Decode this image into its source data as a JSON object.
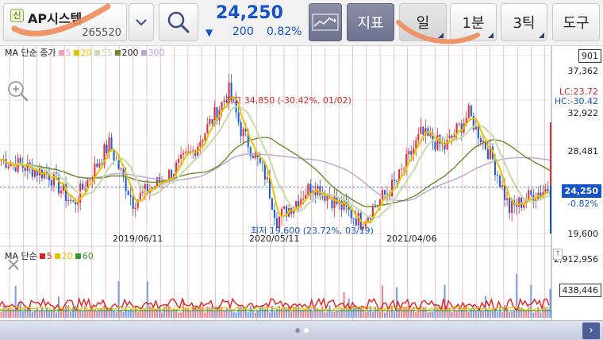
{
  "header": {
    "badge": "신",
    "stock_name": "AP시스템",
    "stock_code": "265520",
    "price": "24,250",
    "change_arrow": "▼",
    "change": "200",
    "change_pct": "0.82%",
    "indicator_btn": "지표",
    "period_day": "일",
    "period_1min": "1분",
    "period_3tick": "3틱",
    "tools_btn": "도구"
  },
  "legend": {
    "label": "MA 단순 종가",
    "items": [
      {
        "label": "5",
        "color": "#f4a0b4"
      },
      {
        "label": "20",
        "color": "#e6c300"
      },
      {
        "label": "55",
        "color": "#c9dcb0"
      },
      {
        "label": "200",
        "color": "#6b8a2a"
      },
      {
        "label": "300",
        "color": "#b9a6d6"
      }
    ]
  },
  "vol_legend": {
    "label": "MA 단순",
    "items": [
      {
        "label": "5",
        "color": "#e02020"
      },
      {
        "label": "20",
        "color": "#e6c300"
      },
      {
        "label": "60",
        "color": "#2e9a2e"
      }
    ]
  },
  "annotations": {
    "high": "최고 34,850 (-30.42%, 01/02)",
    "low": "최저 19,600 (23.72%, 03/19)"
  },
  "chart_data": {
    "type": "candlestick",
    "x_labels": [
      "2019/06/11",
      "2020/05/11",
      "2021/04/06"
    ],
    "y_ticks": [
      37362,
      32922,
      28481,
      24250,
      19600
    ],
    "ylim": [
      19600,
      37362
    ],
    "current_price": 24250,
    "current_change_pct": "-0.82%",
    "lc": "LC:23.72",
    "hc": "HC:-30.42",
    "top_box": "901",
    "high": 34850,
    "low": 19600,
    "volume_ticks": [
      "2,912,956",
      "438,446"
    ],
    "moving_averages": [
      "5",
      "20",
      "55",
      "200",
      "300"
    ]
  },
  "yaxis": {
    "top": "901",
    "t1": "37,362",
    "lc": "LC:23.72",
    "hc": "HC:-30.42",
    "t2": "32,922",
    "t3": "28,481",
    "current": "24,250",
    "pct": "-0.82%",
    "t4": "19,600",
    "vol1": "2,912,956",
    "vol2": "438,446"
  },
  "colors": {
    "up": "#e0303a",
    "down": "#1e5fd6",
    "accent": "#1554c8"
  }
}
